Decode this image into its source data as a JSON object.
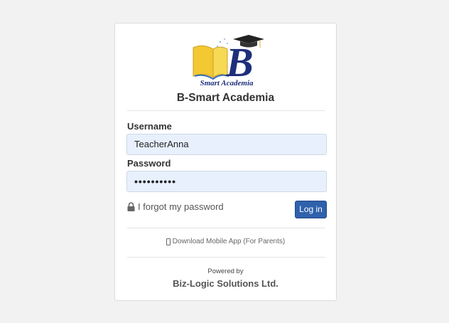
{
  "logo": {
    "text": "Smart Academia",
    "letter": "B"
  },
  "school_name": "B-Smart Academia",
  "form": {
    "username_label": "Username",
    "username_value": "TeacherAnna",
    "password_label": "Password",
    "password_value": "••••••••••",
    "forgot_label": "I forgot my password",
    "login_label": "Log in"
  },
  "download_label": "Download Mobile App (For Parents)",
  "footer": {
    "powered_by": "Powered by",
    "company": "Biz-Logic Solutions Ltd."
  },
  "colors": {
    "primary_button": "#2f61ac",
    "input_fill": "#e8f0fe",
    "logo_blue": "#1e2f7a",
    "logo_yellow": "#f2c833"
  },
  "icons": [
    "lock-icon",
    "mobile-phone-icon",
    "graduation-cap-icon",
    "book-icon"
  ]
}
